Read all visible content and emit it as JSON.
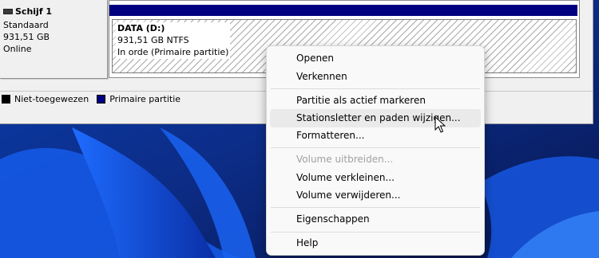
{
  "disk": {
    "title": "Schijf 1",
    "type": "Standaard",
    "size": "931,51 GB",
    "status": "Online"
  },
  "partition": {
    "name": "DATA  (D:)",
    "details": "931,51 GB NTFS",
    "status": "In orde (Primaire partitie)",
    "color": "#000080"
  },
  "legend": {
    "items": [
      {
        "label": "Niet-toegewezen",
        "color": "#000000"
      },
      {
        "label": "Primaire partitie",
        "color": "#000080"
      }
    ]
  },
  "context_menu": {
    "items": [
      {
        "label": "Openen"
      },
      {
        "label": "Verkennen"
      },
      {
        "label": "Partitie als actief markeren"
      },
      {
        "label": "Stationsletter en paden wijzigen..."
      },
      {
        "label": "Formatteren..."
      },
      {
        "label": "Volume uitbreiden..."
      },
      {
        "label": "Volume verkleinen..."
      },
      {
        "label": "Volume verwijderen..."
      },
      {
        "label": "Eigenschappen"
      },
      {
        "label": "Help"
      }
    ]
  }
}
